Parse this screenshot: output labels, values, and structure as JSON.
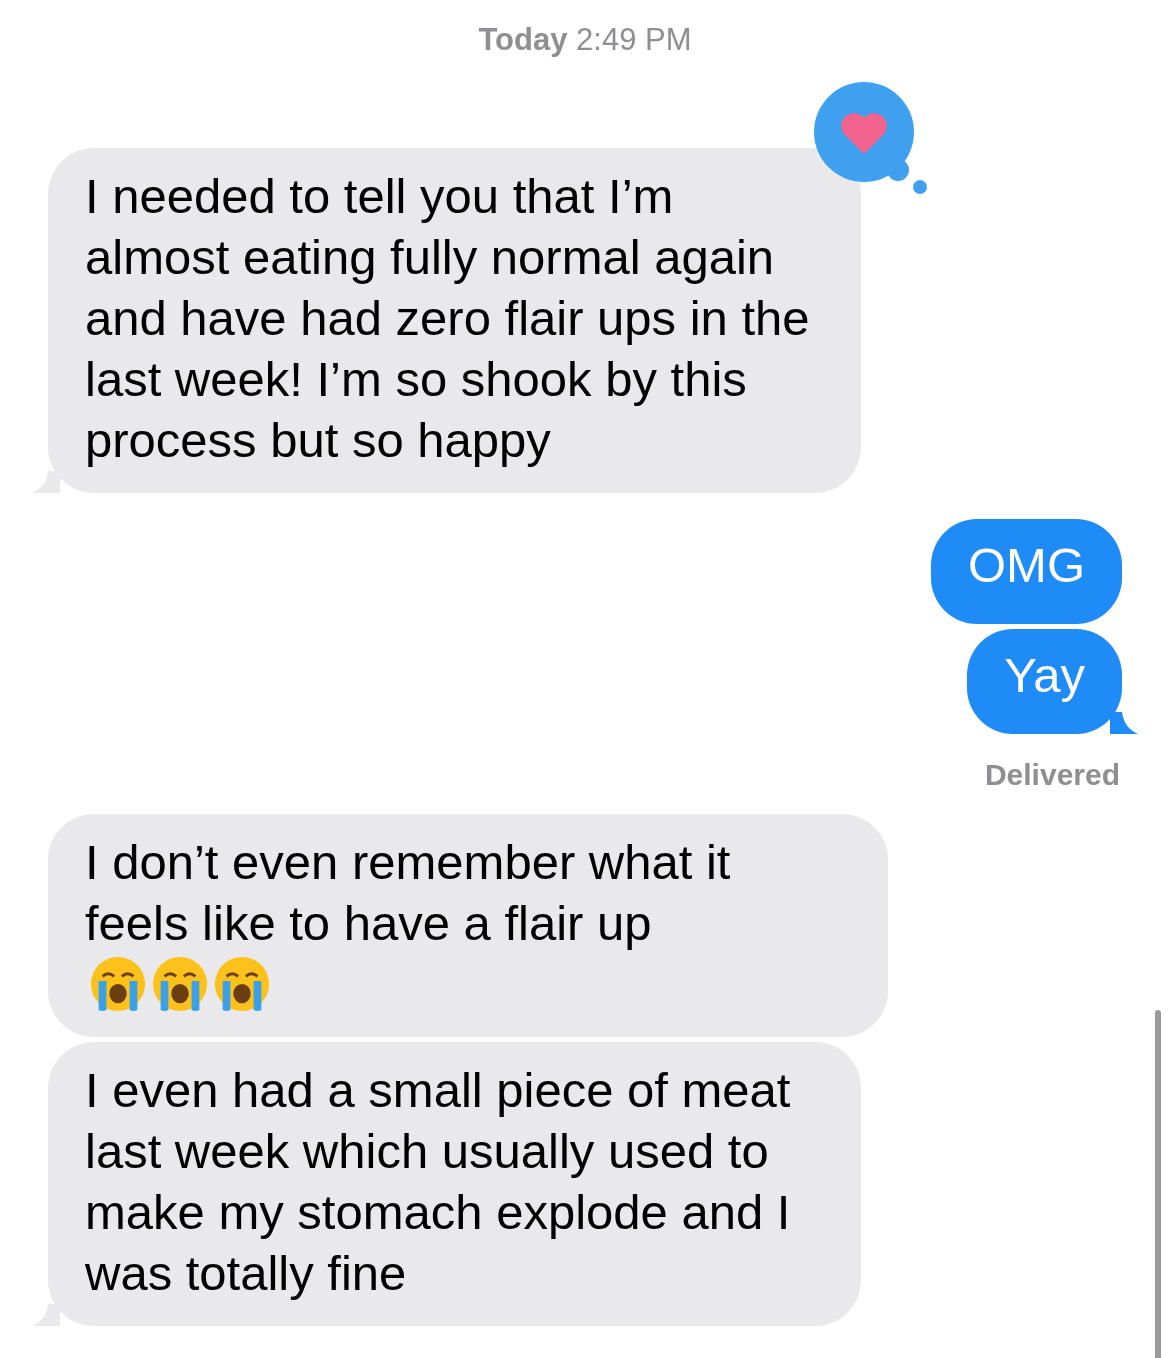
{
  "timestamp": "**Today** 2:49 PM",
  "messages": [
    {
      "kind": "incoming",
      "text": "I needed to tell you that I’m almost eating fully normal again and have had zero flair ups in the last week! I’m so shook by this process but so happy",
      "tail": true,
      "hearted": true
    },
    {
      "kind": "outgoing",
      "text": "OMG",
      "tail": false,
      "hearted": false
    },
    {
      "kind": "outgoing",
      "text": "Yay",
      "tail": true,
      "hearted": false,
      "status": "Delivered"
    },
    {
      "kind": "incoming",
      "text": "I don’t even remember what it feels like to have a flair up",
      "tail": false,
      "hearted": false,
      "emojis": [
        {
          "kind": "crying-face"
        },
        {
          "kind": "crying-face"
        },
        {
          "kind": "crying-face"
        }
      ]
    },
    {
      "kind": "incoming",
      "text": "I even had a small piece of meat last week which usually used to make my stomach explode and I was totally fine",
      "tail": true,
      "hearted": false
    }
  ]
}
